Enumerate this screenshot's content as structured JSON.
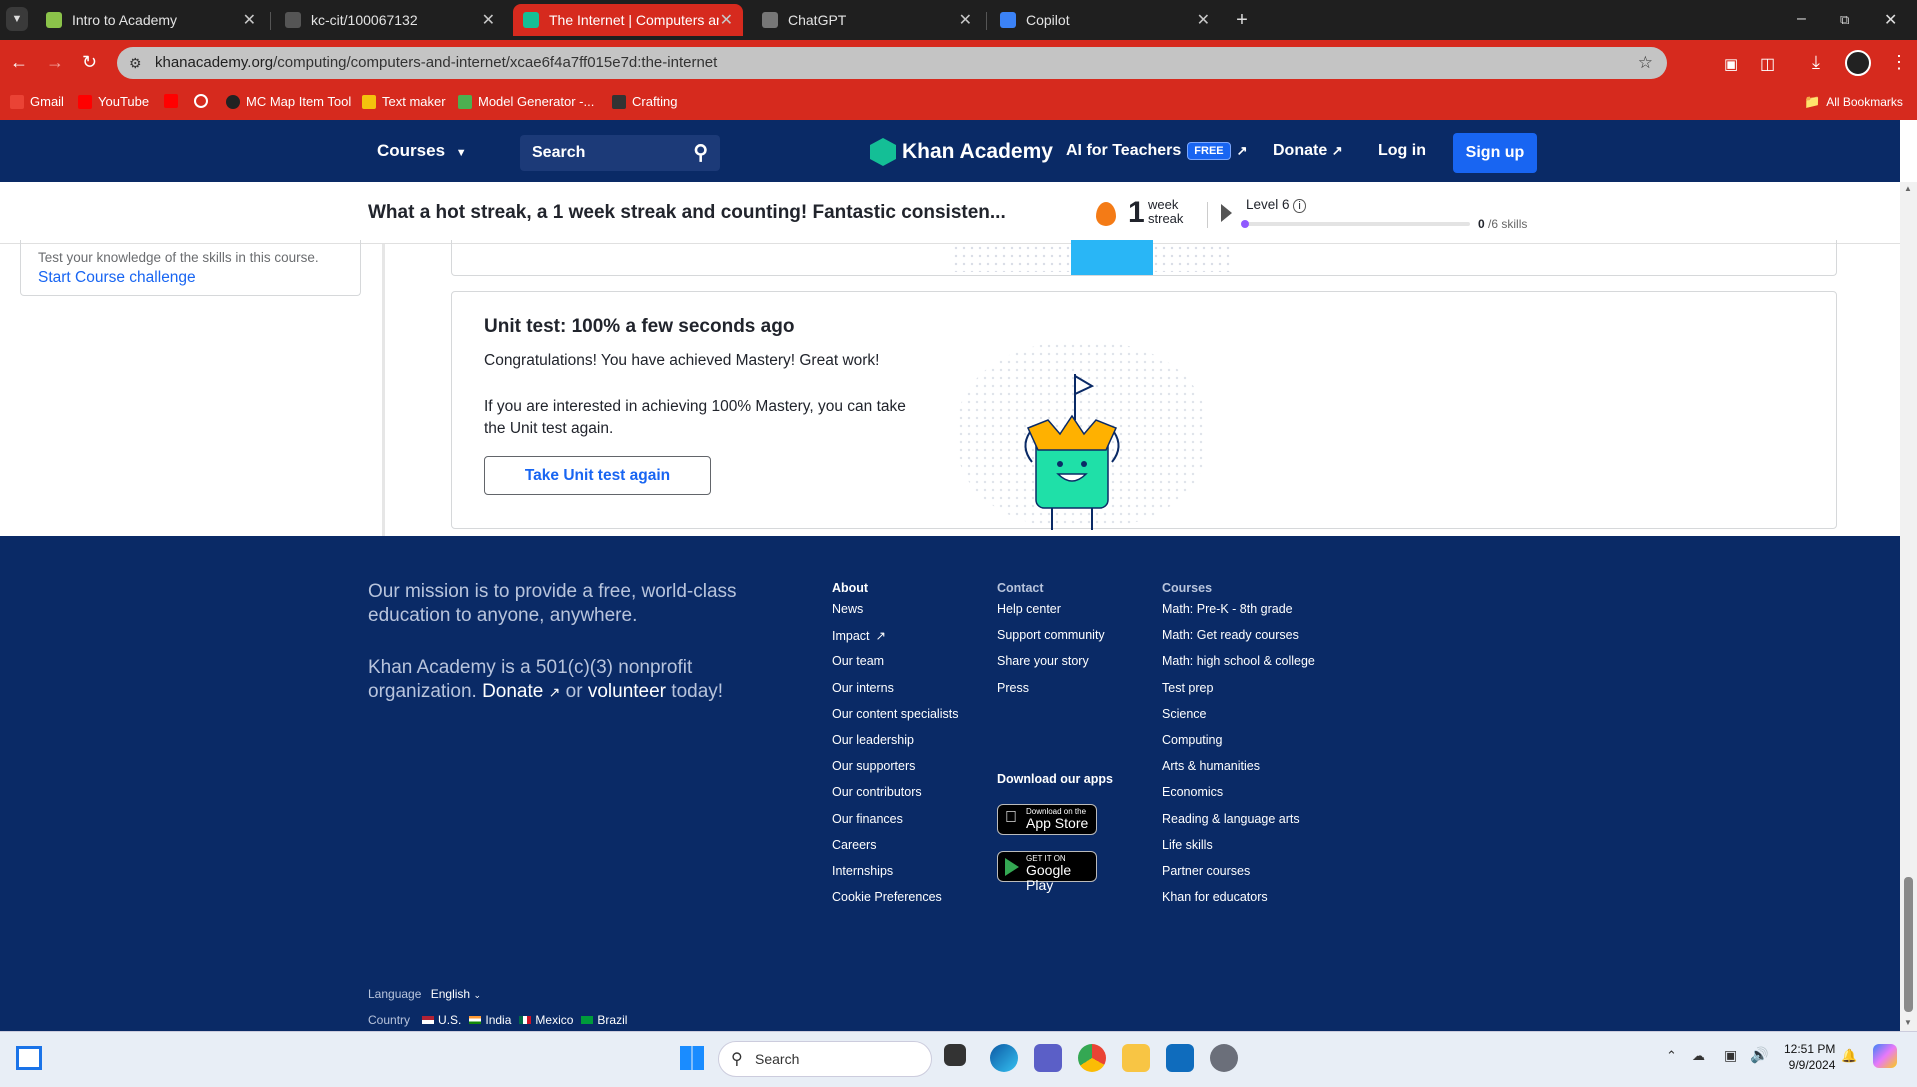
{
  "browser": {
    "tabs": [
      {
        "title": "Intro to Academy",
        "color": "#8bc34a"
      },
      {
        "title": "kc-cit/100067132",
        "color": "#555555"
      },
      {
        "title": "The Internet | Computers and t",
        "color": "#14bf96",
        "active": true
      },
      {
        "title": "ChatGPT",
        "color": "#777777"
      },
      {
        "title": "Copilot",
        "color": "#3b82f6"
      }
    ],
    "url_host": "khanacademy.org",
    "url_path": "/computing/computers-and-internet/xcae6f4a7ff015e7d:the-internet",
    "bookmarks": [
      {
        "label": "Gmail",
        "color": "#ea4335"
      },
      {
        "label": "YouTube",
        "color": "#ff0000"
      },
      {
        "label": "",
        "color": "#ff0000"
      },
      {
        "label": "",
        "color": "#ffffff"
      },
      {
        "label": "MC Map Item Tool",
        "color": "#222222"
      },
      {
        "label": "Text maker",
        "color": "#f4c20d"
      },
      {
        "label": "Model Generator -...",
        "color": "#4caf50"
      },
      {
        "label": "Crafting",
        "color": "#333333"
      }
    ],
    "all_bookmarks": "All Bookmarks"
  },
  "header": {
    "courses": "Courses",
    "search": "Search",
    "logo": "Khan Academy",
    "ai_teachers": "AI for Teachers",
    "free_badge": "FREE",
    "donate": "Donate",
    "login": "Log in",
    "signup": "Sign up"
  },
  "streak": {
    "message": "What a hot streak, a 1 week streak and counting! Fantastic consisten...",
    "count": "1",
    "unit_line1": "week",
    "unit_line2": "streak",
    "level": "Level 6",
    "skills_done": "0",
    "skills_total": "/6 skills",
    "progress_fraction": 0
  },
  "sidebar": {
    "challenge_text": "Test your knowledge of the skills in this course.",
    "challenge_link": "Start Course challenge"
  },
  "unit_test": {
    "title": "Unit test: 100% a few seconds ago",
    "congrats": "Congratulations! You have achieved Mastery! Great work!",
    "info": "If you are interested in achieving 100% Mastery, you can take the Unit test again.",
    "button": "Take Unit test again"
  },
  "footer": {
    "mission": "Our mission is to provide a free, world-class education to anyone, anywhere.",
    "nonprofit_pre": "Khan Academy is a 501(c)(3) nonprofit organization.",
    "nonprofit_donate": "Donate",
    "nonprofit_or": "or",
    "nonprofit_volunteer": "volunteer",
    "nonprofit_post": "today!",
    "about_head": "About",
    "about": [
      "News",
      "Impact",
      "Our team",
      "Our interns",
      "Our content specialists",
      "Our leadership",
      "Our supporters",
      "Our contributors",
      "Our finances",
      "Careers",
      "Internships",
      "Cookie Preferences"
    ],
    "contact_head": "Contact",
    "contact": [
      "Help center",
      "Support community",
      "Share your story",
      "Press"
    ],
    "apps_head": "Download our apps",
    "appstore_small": "Download on the",
    "appstore_big": "App Store",
    "googleplay_small": "GET IT ON",
    "googleplay_big": "Google Play",
    "courses_head": "Courses",
    "courses": [
      "Math: Pre-K - 8th grade",
      "Math: Get ready courses",
      "Math: high school & college",
      "Test prep",
      "Science",
      "Computing",
      "Arts & humanities",
      "Economics",
      "Reading & language arts",
      "Life skills",
      "Partner courses",
      "Khan for educators"
    ],
    "language_label": "Language",
    "language_value": "English",
    "country_label": "Country",
    "countries": [
      "U.S.",
      "India",
      "Mexico",
      "Brazil"
    ]
  },
  "taskbar": {
    "search": "Search",
    "time": "12:51 PM",
    "date": "9/9/2024"
  }
}
